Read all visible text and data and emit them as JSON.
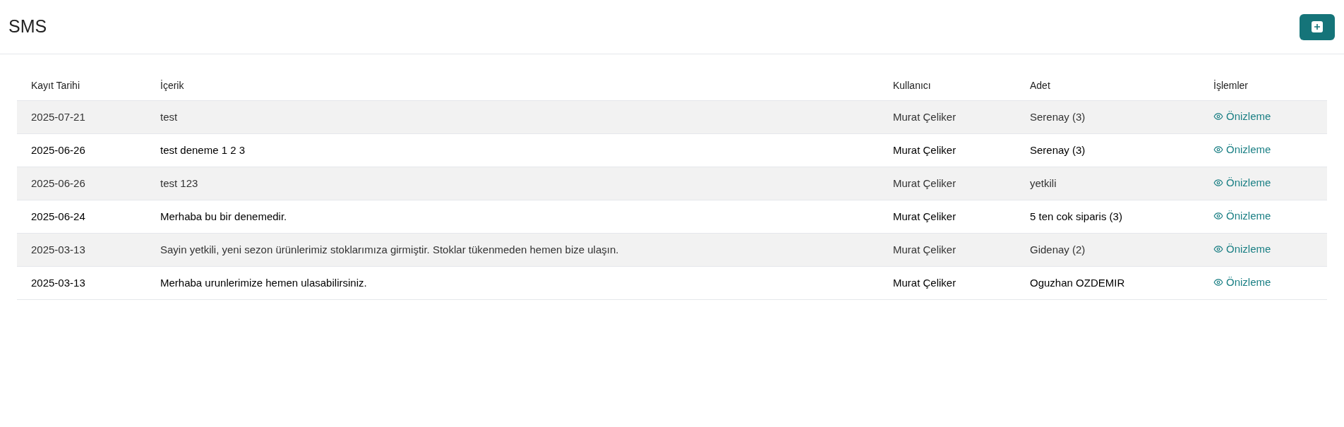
{
  "page": {
    "title": "SMS"
  },
  "table": {
    "columns": [
      "Kayıt Tarihi",
      "İçerik",
      "Kullanıcı",
      "Adet",
      "İşlemler"
    ],
    "rows": [
      {
        "date": "2025-07-21",
        "content": "test",
        "user": "Murat Çeliker",
        "count": "Serenay (3)",
        "action": "Önizleme"
      },
      {
        "date": "2025-06-26",
        "content": "test deneme 1 2 3",
        "user": "Murat Çeliker",
        "count": "Serenay (3)",
        "action": "Önizleme"
      },
      {
        "date": "2025-06-26",
        "content": "test 123",
        "user": "Murat Çeliker",
        "count": "yetkili",
        "action": "Önizleme"
      },
      {
        "date": "2025-06-24",
        "content": "Merhaba bu bir denemedir.",
        "user": "Murat Çeliker",
        "count": "5 ten cok siparis (3)",
        "action": "Önizleme"
      },
      {
        "date": "2025-03-13",
        "content": "Sayin yetkili, yeni sezon ürünlerimiz stoklarımıza girmiştir. Stoklar tükenmeden hemen bize ulaşın.",
        "user": "Murat Çeliker",
        "count": "Gidenay (2)",
        "action": "Önizleme"
      },
      {
        "date": "2025-03-13",
        "content": "Merhaba urunlerimize hemen ulasabilirsiniz.",
        "user": "Murat Çeliker",
        "count": "Oguzhan OZDEMIR",
        "action": "Önizleme"
      }
    ]
  }
}
